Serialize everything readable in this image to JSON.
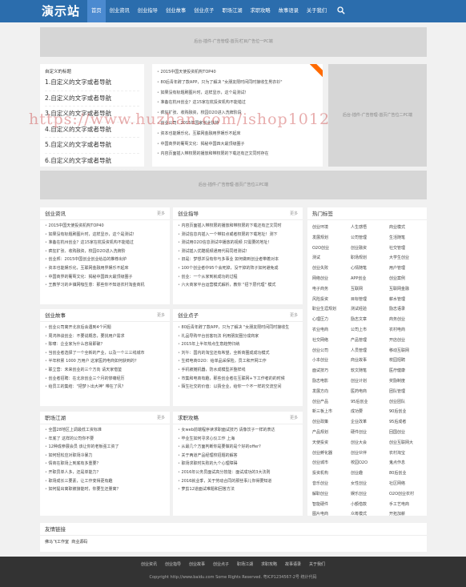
{
  "header": {
    "logo": "演示站",
    "nav": [
      "首页",
      "创业资讯",
      "创业指导",
      "创业故事",
      "创业点子",
      "职场江湖",
      "求职攻略",
      "故事语录",
      "关于我们"
    ]
  },
  "ads": {
    "top": "后台-插件-广告管理-首页/栏目广告位一PC端",
    "middle": "后台-插件-广告管理-首页广告位三PC端",
    "side": "后台-插件-广告管理-首页广告位二PC端"
  },
  "custom": {
    "title": "自定义的标题",
    "items": [
      "1.自定义的文字或者导航",
      "2.自定义的文字或者导航",
      "3.自定义的文字或者导航",
      "4.自定义的文字或者导航",
      "5.自定义的文字或者导航",
      "6.自定义的文字或者导航"
    ]
  },
  "headlines": [
    "2015中国天使投资机构TOP40",
    "80后青年辞了款APP，只为了解决 \"女朋友限时间同时接收生男衣衫\"",
    "如果没有标题刷图片时，这样显示，这个是测试！",
    "准备在杭州创业？这15家在杭投资机构不能错过",
    "疯狂扩张、收购融资，校园O2O进入洗牌阶段",
    "创业公司：2015年国家创业扶持",
    "资本也能娱乐化，互联网金融用界娱乐不起床",
    "中国商界的葡萄文化：揭秘中国四大最顶级圈子",
    "内容页面插入带权限的播放和带权限的下载还有正文同时存在"
  ],
  "more": "更多",
  "sections": [
    {
      "title": "创业资讯",
      "items": [
        "2015中国天使投资机构TOP40",
        "如果没有标题刷图片时，这样显示，这个是测试！",
        "准备在杭州创业？这15家在杭投资机构不能错过",
        "疯狂扩张、收购融资，校园O2O进入洗牌阶",
        "创业邦：2015中国创业创业给总的推荐出炉",
        "资本也能娱乐化，互联网金融用界娱乐不起床",
        "中国商界的葡萄文化：揭秘中国四大最顶级圈子",
        "王教学习的乡镇网咖生意：那些你不知道农村淘金商机"
      ]
    },
    {
      "title": "创业指导",
      "items": [
        "内容页面插入带权限的播放和带权限的下载还有正文同时",
        "测试信息内插入一个带扣点或者权限的下载地址！测下",
        "测试用O2O信息测试中播放的视频 只需要的地址！",
        "测试插入优酷视频通用代码同增测试！",
        "旧是：梦想并没有你与多事业 如何做到创业者带着对本",
        "100个创业者中95个会死掉，没干掉的阵子如何避免成",
        "创业：一个从家到就成功的过程",
        "六大商家平台运营模式解析，教你 \"招下层代理\" 模式"
      ]
    },
    {
      "title": "创业故事",
      "items": [
        "创业公司离开北京后会遇到4个问题",
        "周鸿祎谈创业：不要说概念，要找用户需求",
        "陈啸：企业家为什么容易即破？",
        "当创业者选择了一个全新的产业，以及一个三三线城市",
        "半年积累 1000 万用户 这家医药电商如何获到的？",
        "联立营：未来创业的三个方向 请天家借鉴",
        "创业者招聘：在北京创业三个月的惨痛经历",
        "给员工的集结：\"把梦卜出大神\" 带在了风？"
      ]
    },
    {
      "title": "创业点子",
      "items": [
        "80后青年辞了款APP，只为了解决 \"女朋友限时间同时接收生",
        "礼品导购平台创客玩法 利用朋友圈分成商家",
        "2015年上半年热点生意趋势归纳",
        "刘午：国内的淘宝还有希望，全新商圈成成功模式",
        "生鲜电商O2O：给单品采保险，员工和开网工作",
        "手机被摊机器，防水成模型并整样线",
        "市集和电商有趣，那些创业者在互联网+下工作者的的时候",
        "陌生社交的价值：以猜全业，给你一个不一样的交流空间"
      ]
    },
    {
      "title": "职场江湖",
      "items": [
        "全国28地区上调最低工资标准",
        "年底了 这样的公司你不要",
        "12种成参展会员 该让你的老板强工资了",
        "如何轻松应对职场冷暴力",
        "情商在职场上到底有多重要？",
        "开职员单人多，还是单能力？",
        "职场成长三要素，让工作变得更有趣",
        "如何提出离职被接能时，你要生还量离？"
      ]
    },
    {
      "title": "求职攻略",
      "items": [
        "女web前端程序读求职面试技巧 请像饮子一样的表达",
        "毕业生如何寻求心仪工作 上海",
        "从最几个方面判断你是要做的是个好的offer?",
        "关于两道产品经理校招题的解答",
        "职场求职时失败的九个心理障碍",
        "2016年公务员面试高分技能：面试成功的3大法则",
        "2016就业季，关于劳动合同的那些事儿你得要知道",
        "萝剪12道面试难题和回答方法"
      ]
    }
  ],
  "hot": {
    "title": "热门标签",
    "tags": [
      "创业环境",
      "人生感悟",
      "商业模式",
      "发展规划",
      "公司管理",
      "生活随笔",
      "O2O创业",
      "创业融资",
      "社交管理",
      "测试",
      "职场规划",
      "大学生创业",
      "创业失败",
      "心情随笔",
      "用户管理",
      "网络创业",
      "APP创业",
      "创业案例",
      "电子商务",
      "互联网",
      "互联网金融",
      "风险投资",
      "目标管理",
      "薪水管理",
      "职业生涯规划",
      "测试经验",
      "励志语录",
      "心理压力",
      "励志文章",
      "商务创业",
      "农业电商",
      "公司上市",
      "农村电商",
      "社交网络",
      "产品管理",
      "开店创业",
      "创业公司",
      "人员管理",
      "移动互联网",
      "小本创业",
      "商业故事",
      "校园招聘",
      "面试技巧",
      "软文随笔",
      "医疗健康",
      "励志电影",
      "创业计划",
      "奖励制度",
      "发展方向",
      "医药电商",
      "团队管理",
      "创业产品",
      "95后创业",
      "创业团队",
      "新三板上市",
      "成功要",
      "90后创业",
      "创业政策",
      "企业改革",
      "95后成者",
      "产品规划",
      "硬件创业",
      "回国创业",
      "天使投资",
      "创业大会",
      "创业互联网大",
      "创业孵化器",
      "创业伙伴",
      "农村淘宝",
      "创业城市",
      "校园O2O",
      "鬼点作息",
      "投资机构",
      "创业趣",
      "80后创业",
      "音乐创业",
      "女性创业",
      "社区网络",
      "解职创业",
      "娱乐创业",
      "O2O创业农村",
      "智能硬件",
      "小额借款",
      "手工艺电商",
      "图片电商",
      "众筹模式",
      "开拓加薪"
    ]
  },
  "friends": {
    "title": "友情链接",
    "links": [
      "佛马飞工作室",
      "商业源码"
    ]
  },
  "footer": {
    "nav": [
      "创业资讯",
      "创业指导",
      "创业故事",
      "创业点子",
      "职场江湖",
      "求职攻略",
      "故事语录",
      "关于我们"
    ],
    "copyright": "Copyright http://www.baidu.com Some Rights Reserved. 粤ICP1234567-2号 统计代码"
  },
  "watermark": "https://www.huzhan.com/ishop1012"
}
